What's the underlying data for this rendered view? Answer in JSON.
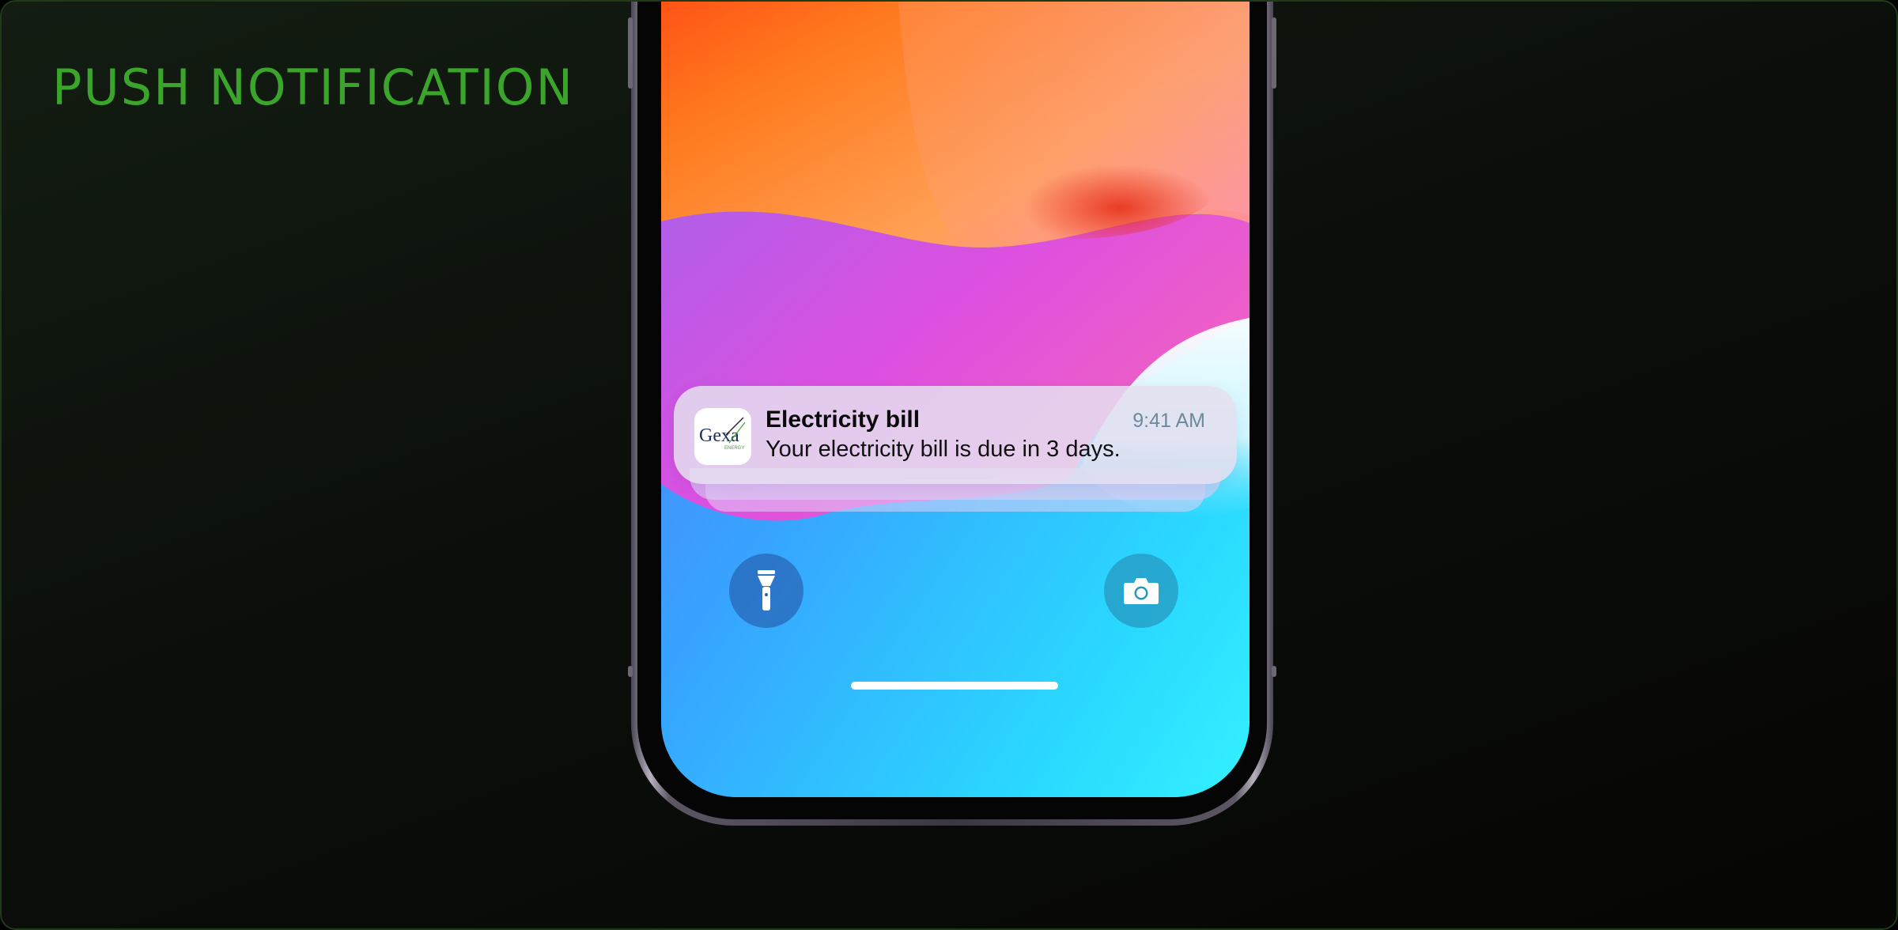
{
  "page": {
    "title": "PUSH NOTIFICATION",
    "title_color": "#3aa52a",
    "background_color": "#0b0f0a"
  },
  "phone": {
    "notification": {
      "app_icon": "gexa-energy-logo-icon",
      "app_icon_text": "Gexa",
      "app_icon_subtext": "ENERGY",
      "title": "Electricity bill",
      "time": "9:41 AM",
      "body": "Your electricity bill is due in 3 days."
    },
    "lock_screen": {
      "left_button_icon": "flashlight-icon",
      "right_button_icon": "camera-icon"
    }
  }
}
